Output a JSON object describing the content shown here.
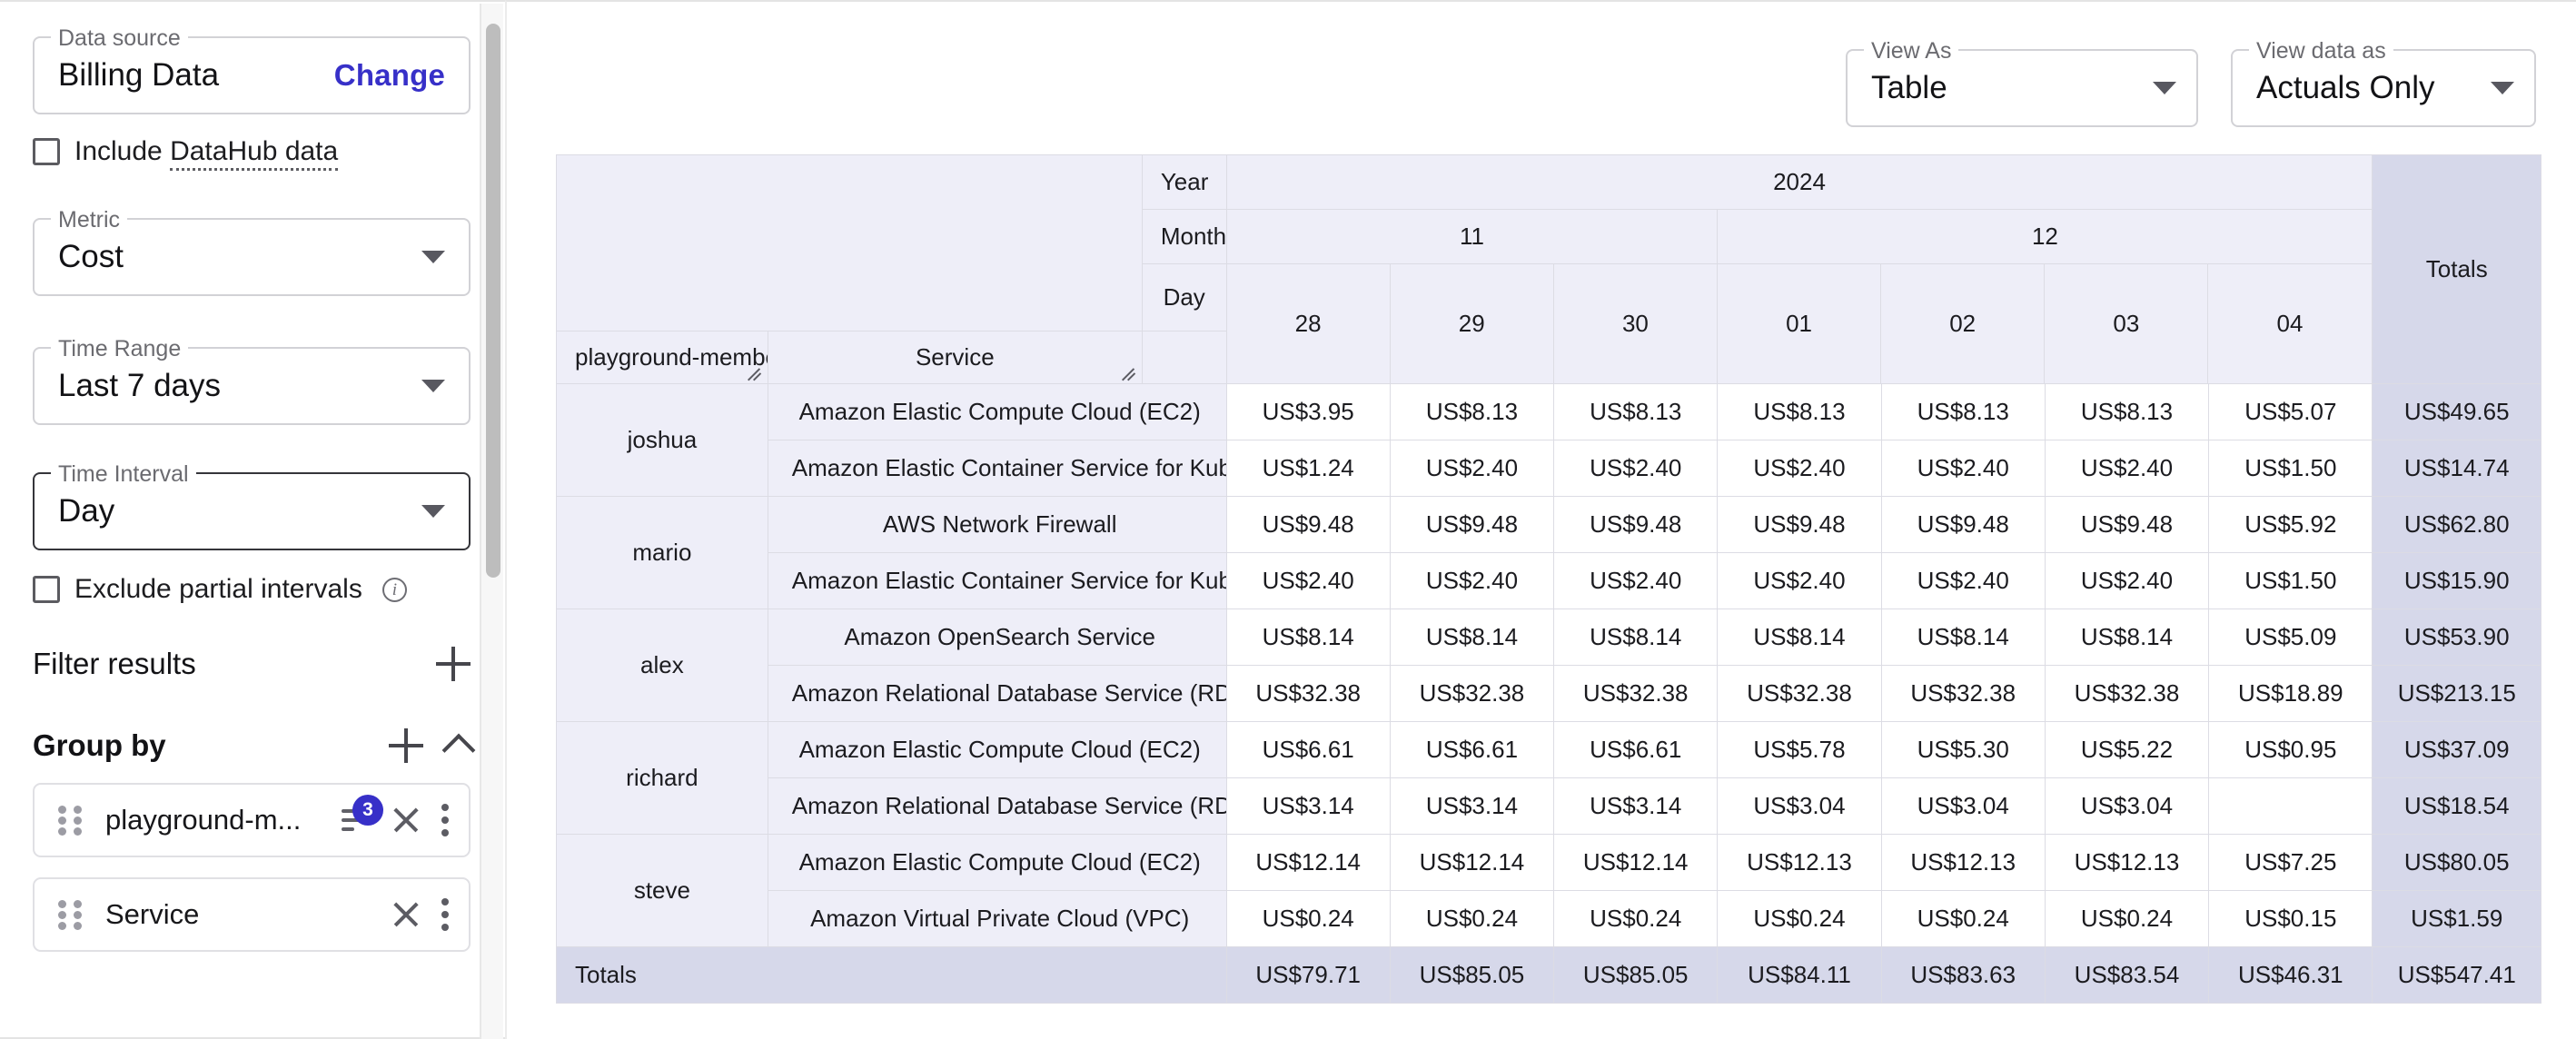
{
  "sidebar": {
    "data_source": {
      "legend": "Data source",
      "value": "Billing Data",
      "action": "Change"
    },
    "include_datahub": {
      "label_prefix": "Include ",
      "label_link": "DataHub data"
    },
    "metric": {
      "legend": "Metric",
      "value": "Cost"
    },
    "time_range": {
      "legend": "Time Range",
      "value": "Last 7 days"
    },
    "time_interval": {
      "legend": "Time Interval",
      "value": "Day"
    },
    "exclude_partial": {
      "label": "Exclude partial intervals",
      "info": "i"
    },
    "filter_results": {
      "title": "Filter results"
    },
    "group_by": {
      "title": "Group by",
      "items": [
        {
          "label": "playground-m...",
          "badge": "3",
          "has_filter": true
        },
        {
          "label": "Service",
          "badge": "",
          "has_filter": false
        }
      ]
    }
  },
  "toolbar": {
    "view_as": {
      "legend": "View As",
      "value": "Table"
    },
    "view_data_as": {
      "legend": "View data as",
      "value": "Actuals Only"
    }
  },
  "table": {
    "axis_labels": {
      "year": "Year",
      "month": "Month",
      "day": "Day"
    },
    "row_dims": [
      "playground-member",
      "Service"
    ],
    "years": [
      {
        "label": "2024",
        "span": 7
      }
    ],
    "months": [
      {
        "label": "11",
        "span": 3
      },
      {
        "label": "12",
        "span": 4
      }
    ],
    "days": [
      "28",
      "29",
      "30",
      "01",
      "02",
      "03",
      "04"
    ],
    "totals_header": "Totals",
    "totals_row_label": "Totals",
    "groups": [
      {
        "member": "joshua",
        "rows": [
          {
            "service": "Amazon Elastic Compute Cloud (EC2)",
            "values": [
              "US$3.95",
              "US$8.13",
              "US$8.13",
              "US$8.13",
              "US$8.13",
              "US$8.13",
              "US$5.07"
            ],
            "total": "US$49.65"
          },
          {
            "service": "Amazon Elastic Container Service for Kub...",
            "values": [
              "US$1.24",
              "US$2.40",
              "US$2.40",
              "US$2.40",
              "US$2.40",
              "US$2.40",
              "US$1.50"
            ],
            "total": "US$14.74"
          }
        ]
      },
      {
        "member": "mario",
        "rows": [
          {
            "service": "AWS Network Firewall",
            "values": [
              "US$9.48",
              "US$9.48",
              "US$9.48",
              "US$9.48",
              "US$9.48",
              "US$9.48",
              "US$5.92"
            ],
            "total": "US$62.80"
          },
          {
            "service": "Amazon Elastic Container Service for Kub...",
            "values": [
              "US$2.40",
              "US$2.40",
              "US$2.40",
              "US$2.40",
              "US$2.40",
              "US$2.40",
              "US$1.50"
            ],
            "total": "US$15.90"
          }
        ]
      },
      {
        "member": "alex",
        "rows": [
          {
            "service": "Amazon OpenSearch Service",
            "values": [
              "US$8.14",
              "US$8.14",
              "US$8.14",
              "US$8.14",
              "US$8.14",
              "US$8.14",
              "US$5.09"
            ],
            "total": "US$53.90"
          },
          {
            "service": "Amazon Relational Database Service (RDS)",
            "values": [
              "US$32.38",
              "US$32.38",
              "US$32.38",
              "US$32.38",
              "US$32.38",
              "US$32.38",
              "US$18.89"
            ],
            "total": "US$213.15"
          }
        ]
      },
      {
        "member": "richard",
        "rows": [
          {
            "service": "Amazon Elastic Compute Cloud (EC2)",
            "values": [
              "US$6.61",
              "US$6.61",
              "US$6.61",
              "US$5.78",
              "US$5.30",
              "US$5.22",
              "US$0.95"
            ],
            "total": "US$37.09"
          },
          {
            "service": "Amazon Relational Database Service (RDS)",
            "values": [
              "US$3.14",
              "US$3.14",
              "US$3.14",
              "US$3.04",
              "US$3.04",
              "US$3.04",
              ""
            ],
            "total": "US$18.54"
          }
        ]
      },
      {
        "member": "steve",
        "rows": [
          {
            "service": "Amazon Elastic Compute Cloud (EC2)",
            "values": [
              "US$12.14",
              "US$12.14",
              "US$12.14",
              "US$12.13",
              "US$12.13",
              "US$12.13",
              "US$7.25"
            ],
            "total": "US$80.05"
          },
          {
            "service": "Amazon Virtual Private Cloud (VPC)",
            "values": [
              "US$0.24",
              "US$0.24",
              "US$0.24",
              "US$0.24",
              "US$0.24",
              "US$0.24",
              "US$0.15"
            ],
            "total": "US$1.59"
          }
        ]
      }
    ],
    "totals_values": [
      "US$79.71",
      "US$85.05",
      "US$85.05",
      "US$84.11",
      "US$83.63",
      "US$83.54",
      "US$46.31"
    ],
    "grand_total": "US$547.41"
  },
  "colors": {
    "accent": "#3730c8",
    "header_bg": "#eeeef8",
    "totals_bg": "#d6d8ea",
    "border": "#dcdce4"
  }
}
